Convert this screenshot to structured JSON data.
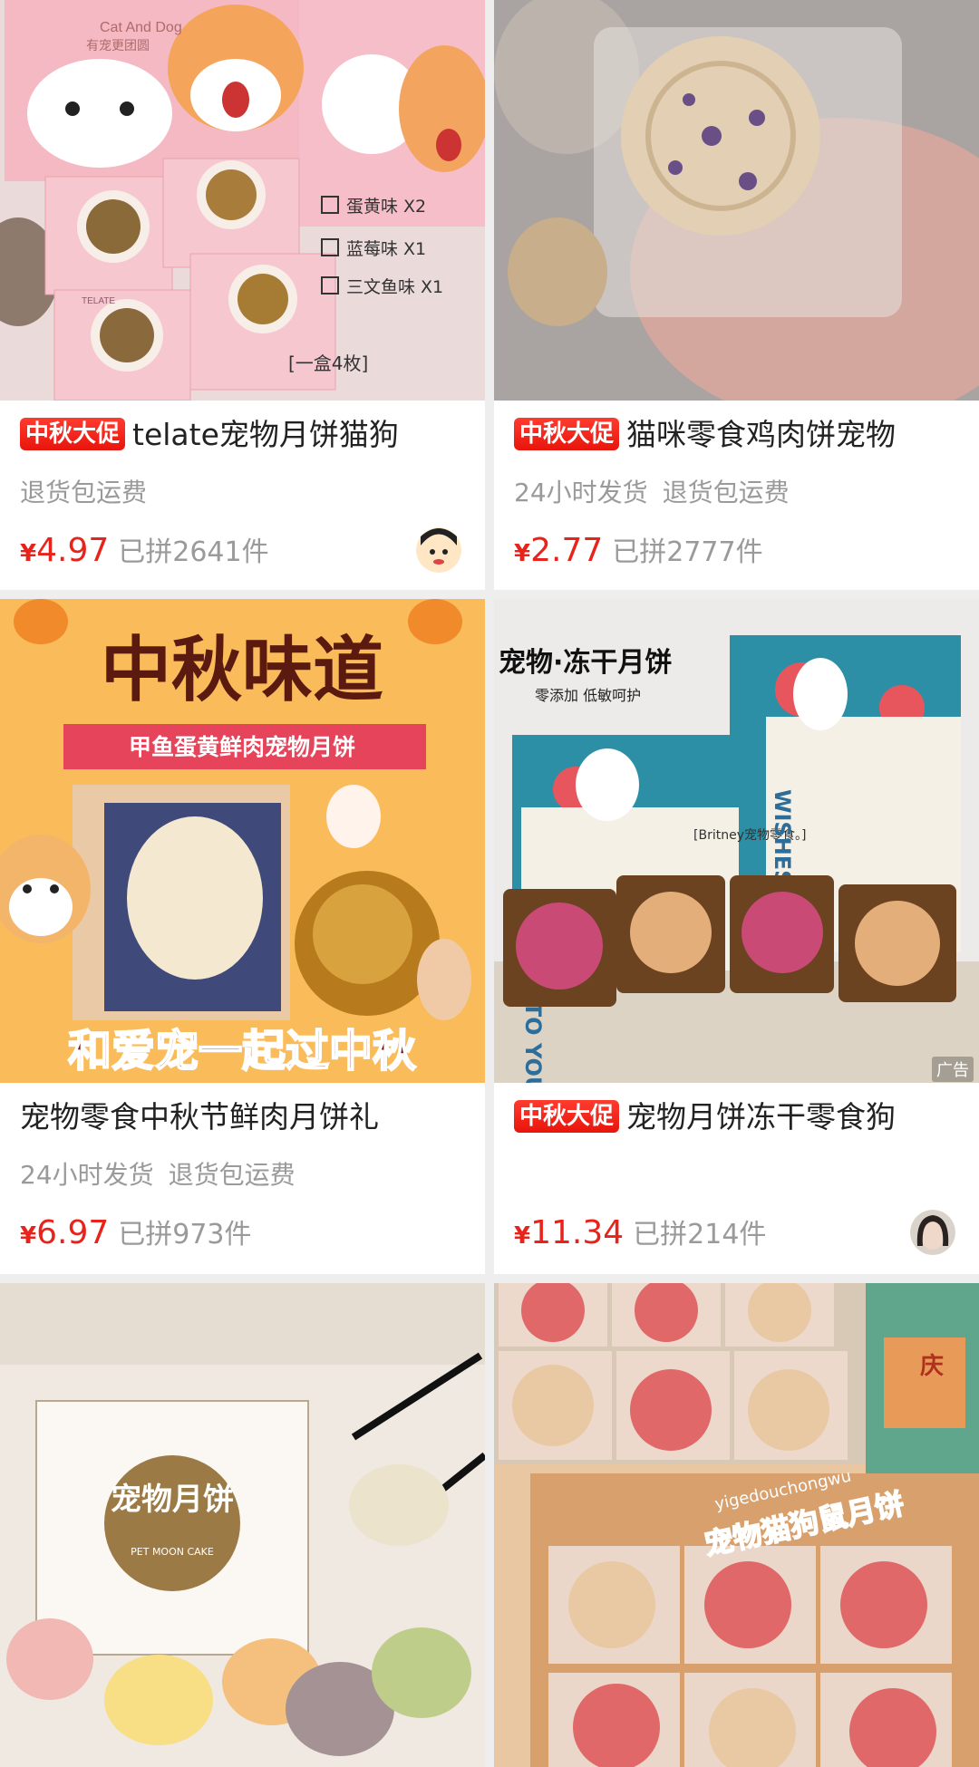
{
  "products": [
    {
      "badge": "中秋大促",
      "title": "telate宠物月饼猫狗",
      "tags": [
        "退货包运费"
      ],
      "currency": "¥",
      "price": "4.97",
      "sold": "已拼2641件",
      "image": {
        "brand": "TELATE",
        "box_text": "Cat And Dog",
        "box_sub": "有宠更团圆",
        "checks": [
          "蛋黄味 X2",
          "蓝莓味 X1",
          "三文鱼味 X1"
        ],
        "caption": "[一盒4枚]"
      }
    },
    {
      "badge": "中秋大促",
      "title": "猫咪零食鸡肉饼宠物",
      "tags": [
        "24小时发货",
        "退货包运费"
      ],
      "currency": "¥",
      "price": "2.77",
      "sold": "已拼2777件"
    },
    {
      "badge": "",
      "title": "宠物零食中秋节鲜肉月饼礼",
      "tags": [
        "24小时发货",
        "退货包运费"
      ],
      "currency": "¥",
      "price": "6.97",
      "sold": "已拼973件",
      "image": {
        "headline": "中秋味道",
        "ribbon": "甲鱼蛋黄鲜肉宠物月饼",
        "footer": "和爱宠一起过中秋"
      }
    },
    {
      "badge": "中秋大促",
      "title": "宠物月饼冻干零食狗",
      "tags": [],
      "currency": "¥",
      "price": "11.34",
      "sold": "已拼214件",
      "image": {
        "headline": "宠物·冻干月饼",
        "sub": "零添加 低敏呵护",
        "watermark": "[Britney宠物零食。]",
        "ad": "广告",
        "card_text_1": "WISHES TO YOU",
        "card_text_2": "WISHES TO YOU"
      }
    },
    {
      "image": {
        "box_text": "宠物月饼",
        "box_sub": "PET MOON CAKE"
      }
    },
    {
      "image": {
        "headline": "宠物猫狗鼠月饼",
        "watermark": "yigedouchongwu",
        "side_text": "庆"
      }
    }
  ],
  "colors": {
    "accent": "#e8231b",
    "muted": "#9a9a9a",
    "background": "#eeeeee"
  }
}
